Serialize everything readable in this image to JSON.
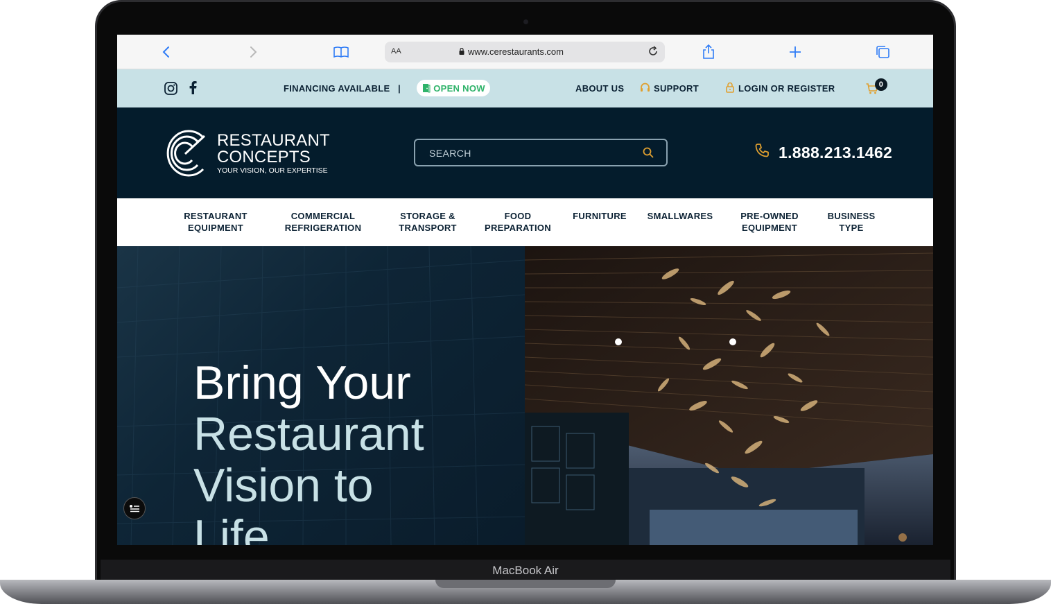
{
  "device": {
    "label": "MacBook Air"
  },
  "browser": {
    "url": "www.cerestaurants.com",
    "text_size_label": "AA"
  },
  "topbar": {
    "financing": "FINANCING AVAILABLE",
    "separator": "|",
    "open_now": "OPEN NOW",
    "about": "ABOUT US",
    "support": "SUPPORT",
    "login": "LOGIN OR REGISTER",
    "cart_count": "0"
  },
  "header": {
    "logo_line1": "RESTAURANT",
    "logo_line2": "CONCEPTS",
    "logo_tagline": "YOUR VISION, OUR EXPERTISE",
    "search_placeholder": "SEARCH",
    "phone": "1.888.213.1462"
  },
  "nav": {
    "items": [
      {
        "label": "RESTAURANT\nEQUIPMENT"
      },
      {
        "label": "COMMERCIAL\nREFRIGERATION"
      },
      {
        "label": "STORAGE &\nTRANSPORT"
      },
      {
        "label": "FOOD\nPREPARATION"
      },
      {
        "label": "FURNITURE"
      },
      {
        "label": "SMALLWARES"
      },
      {
        "label": "PRE-OWNED\nEQUIPMENT"
      },
      {
        "label": "BUSINESS\nTYPE"
      }
    ]
  },
  "hero": {
    "line1": "Bring Your",
    "line2": "Restaurant",
    "line3": "Vision to",
    "line4": "Life"
  },
  "colors": {
    "accent_teal": "#c8e1e6",
    "navy": "#041c2c",
    "gold": "#e0a030",
    "green": "#2fb36a"
  },
  "icons": [
    "back-icon",
    "forward-icon",
    "bookmarks-icon",
    "lock-icon",
    "reload-icon",
    "share-icon",
    "new-tab-icon",
    "tabs-icon",
    "instagram-icon",
    "facebook-icon",
    "door-icon",
    "headset-icon",
    "lock-icon",
    "cart-icon",
    "search-icon",
    "phone-icon",
    "accessibility-icon"
  ]
}
